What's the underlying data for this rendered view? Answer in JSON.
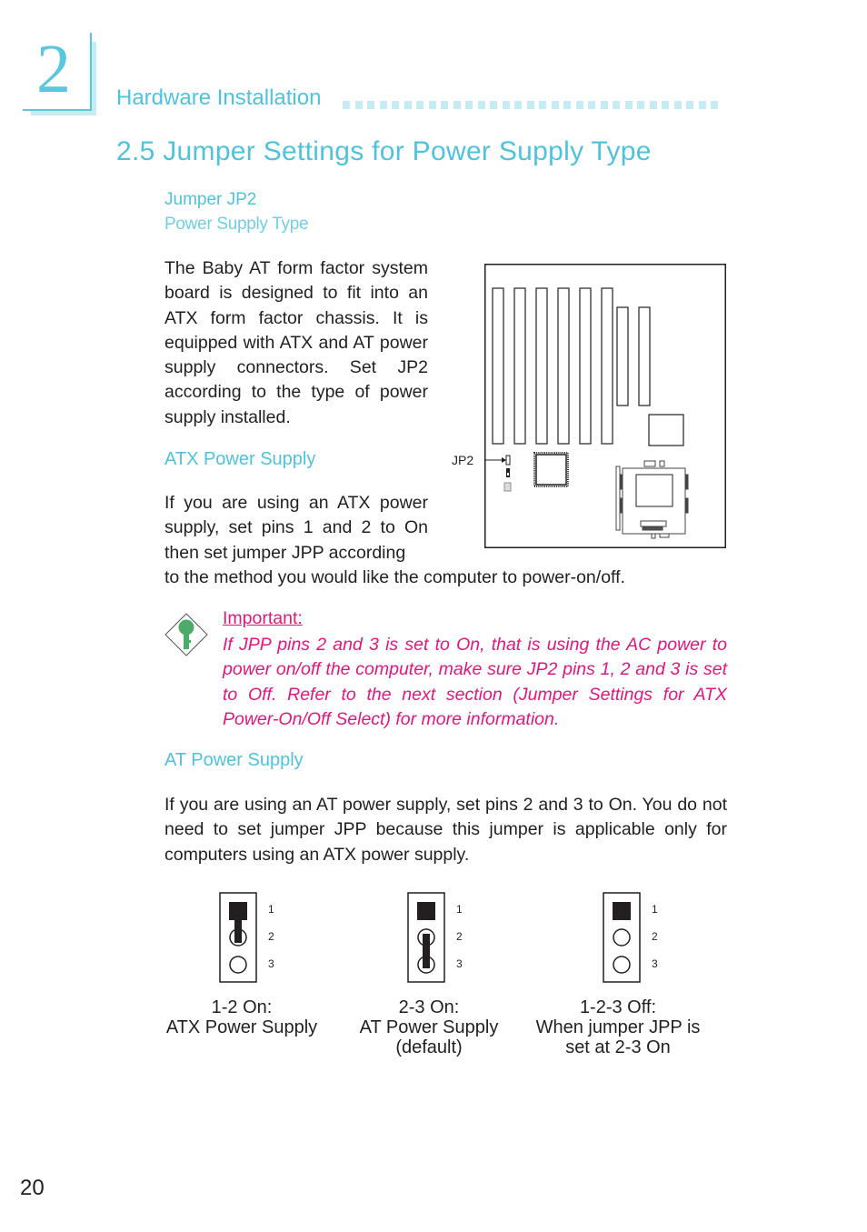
{
  "chapter": {
    "number": "2",
    "running_title": "Hardware Installation"
  },
  "section": {
    "title": "2.5  Jumper Settings  for  Power  Supply  Type"
  },
  "jumper": {
    "title": "Jumper JP2",
    "subtitle": "Power Supply Type",
    "intro": "The Baby AT form factor system board is designed to fit into an ATX form factor chassis. It is equipped with ATX and AT power supply connectors. Set JP2 according to the type of power supply installed."
  },
  "board_diagram": {
    "jp2_label": "JP2"
  },
  "atx": {
    "heading": "ATX Power Supply",
    "text_wrapped": "If you are using an ATX power supply, set pins 1 and 2 to On then set jumper JPP according",
    "text_full": "to the method you would like the computer to power-on/off."
  },
  "important": {
    "label": "Important:",
    "icon": "key-icon",
    "text": "If JPP pins 2 and 3 is set to On, that is using the AC power to power on/off the computer, make sure JP2 pins 1, 2 and 3 is set to Off. Refer to the next section (Jumper Settings for ATX Power-On/Off Select) for more information.",
    "color": "#e0177f"
  },
  "at": {
    "heading": "AT Power Supply",
    "text": "If you are using an AT power supply, set pins 2 and 3 to On. You do not need to set jumper JPP because this jumper is applicable only for computers using an ATX power supply."
  },
  "jumper_settings": [
    {
      "pins": [
        "1",
        "2",
        "3"
      ],
      "jumpered": "1-2",
      "caption_line1": "1-2 On:",
      "caption_line2": "ATX Power Supply",
      "caption_line3": ""
    },
    {
      "pins": [
        "1",
        "2",
        "3"
      ],
      "jumpered": "2-3",
      "caption_line1": "2-3 On:",
      "caption_line2": "AT Power Supply",
      "caption_line3": "(default)"
    },
    {
      "pins": [
        "1",
        "2",
        "3"
      ],
      "jumpered": "none",
      "caption_line1": "1-2-3 Off:",
      "caption_line2": "When jumper JPP is",
      "caption_line3": "set at 2-3 On"
    }
  ],
  "colors": {
    "accent": "#4fc3dc",
    "accent_light": "#c6ebf3",
    "important": "#e0177f",
    "key_green": "#4caa6a"
  },
  "page_number": "20"
}
